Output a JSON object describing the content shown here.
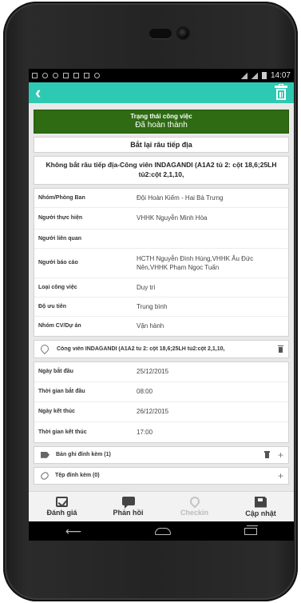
{
  "statusbar": {
    "time": "14:07"
  },
  "toolbar": {
    "back_icon": "chevron-left-icon",
    "delete_icon": "trash-icon"
  },
  "status": {
    "label": "Trạng thái công việc",
    "value": "Đã hoàn thành",
    "color": "#2e6b12"
  },
  "action_label": "Bắt lại râu tiếp địa",
  "task_title": "Không bắt râu tiếp địa-Công viên INDAGANDI (A1A2 tủ 2: cột 18,6;25LH tủ2:cột 2,1,10,",
  "details": [
    {
      "key": "Nhóm/Phòng Ban",
      "value": "Đội Hoàn Kiếm - Hai Bà Trưng"
    },
    {
      "key": "Người thực hiện",
      "value": "VHHK Nguyễn Minh Hòa"
    },
    {
      "key": "Người liên quan",
      "value": ""
    },
    {
      "key": "Người báo cáo",
      "value": "HCTH Nguyễn Đình Hùng,VHHK Âu Đức Nên,VHHK Phạm Ngọc Tuấn"
    },
    {
      "key": "Loại công việc",
      "value": "Duy trì"
    },
    {
      "key": "Độ ưu tiên",
      "value": "Trung bình"
    },
    {
      "key": "Nhóm CV/Dự án",
      "value": "Vận hành"
    }
  ],
  "location": {
    "text": "Công viên INDAGANDI (A1A2 tủ 2: cột 18,6;25LH tủ2:cột 2,1,10,"
  },
  "dates": [
    {
      "key": "Ngày bắt đầu",
      "value": "25/12/2015"
    },
    {
      "key": "Thời gian bắt đầu",
      "value": "08:00"
    },
    {
      "key": "Ngày kết thúc",
      "value": "26/12/2015"
    },
    {
      "key": "Thời gian kết thúc",
      "value": "17:00"
    }
  ],
  "records": {
    "label": "Bản ghi đính kèm (1)"
  },
  "attachments": {
    "label": "Tệp đính kèm (0)"
  },
  "bottom_actions": [
    {
      "label": "Đánh giá",
      "icon": "evaluate-icon"
    },
    {
      "label": "Phản hồi",
      "icon": "chat-icon"
    },
    {
      "label": "Checkin",
      "icon": "location-pin-icon"
    },
    {
      "label": "Cập nhật",
      "icon": "save-icon"
    }
  ],
  "accent_color": "#2ec9b3"
}
